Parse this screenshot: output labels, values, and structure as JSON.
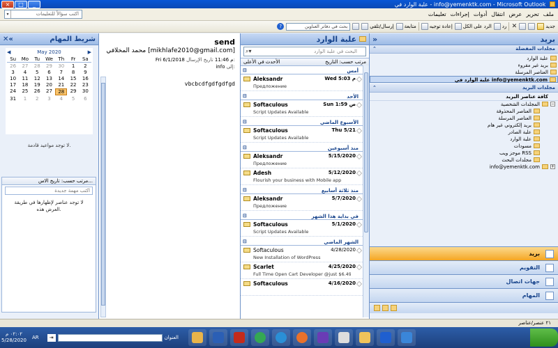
{
  "window": {
    "title": "علبة الوارد في - info@yemenktk.com - Microsoft Outlook",
    "controls": [
      "_",
      "□",
      "×"
    ]
  },
  "menu": {
    "items": [
      "ملف",
      "تحرير",
      "عرض",
      "انتقال",
      "أدوات",
      "إجراءات",
      "تعليمات"
    ],
    "ask_placeholder": "اكتب سؤالاً للتعليمات"
  },
  "toolbar": {
    "new_label": "جديد",
    "reply_label": "رد",
    "reply_all_label": "الرد على الكل",
    "forward_label": "إعادة توجيه",
    "followup_label": "متابعة",
    "sendreceive_label": "إرسال/تلقي",
    "search_placeholder": "بحث في دفاتر العناوين"
  },
  "todo": {
    "title": "شريط المهام",
    "calendar": {
      "month": "May 2020",
      "weekdays": [
        "Su",
        "Mo",
        "Tu",
        "We",
        "Th",
        "Fr",
        "Sa"
      ],
      "cells": [
        "26",
        "27",
        "28",
        "29",
        "30",
        "1",
        "2",
        "3",
        "4",
        "5",
        "6",
        "7",
        "8",
        "9",
        "10",
        "11",
        "12",
        "13",
        "14",
        "15",
        "16",
        "17",
        "18",
        "19",
        "20",
        "21",
        "22",
        "23",
        "24",
        "25",
        "26",
        "27",
        "28",
        "29",
        "30",
        "31",
        "1",
        "2",
        "3",
        "4",
        "5",
        "6"
      ],
      "today": "28"
    },
    "no_appointments": "لا توجد مواعيد قادمة.",
    "tasks": {
      "sort_header": "مرتب حسب: تاريخ الاس...",
      "new_placeholder": "اكتب مهمة جديدة",
      "empty_text": "لا توجد عناصر لإظهارها في طريقة العرض هذه."
    }
  },
  "reading": {
    "subject": "send",
    "from": "محمد المخلافي [mikhlafe2010@gmail.com]",
    "sent_label": "تاريخ الإرسال:",
    "sent_value": "Fri 6/1/2018 م 11:46",
    "to_label": "إلى:",
    "to_value": "info",
    "body": "vbcbcdfgdfgdfgd"
  },
  "inbox": {
    "title": "علبة الوارد",
    "search_placeholder": "البحث في علبة الوارد",
    "sort_by": "مرتب حسب: التاريخ",
    "sort_order": "الأحدث في الأعلى",
    "groups": [
      {
        "label": "أمس",
        "messages": [
          {
            "sender": "Aleksandr",
            "date": "Wed 5:03 م",
            "snippet": "Предложение",
            "read": false
          }
        ]
      },
      {
        "label": "الأحد",
        "messages": [
          {
            "sender": "Softaculous",
            "date": "Sun 1:59 ص",
            "snippet": "Script Updates Available",
            "read": false
          }
        ]
      },
      {
        "label": "الأسبوع الماضي",
        "messages": [
          {
            "sender": "Softaculous",
            "date": "Thu 5/21",
            "snippet": "Script Updates Available",
            "read": false
          }
        ]
      },
      {
        "label": "منذ أسبوعين",
        "messages": [
          {
            "sender": "Aleksandr",
            "date": "5/15/2020",
            "snippet": "Предложение",
            "read": false
          },
          {
            "sender": "Adesh",
            "date": "5/12/2020",
            "snippet": "Flourish your business with Mobile app",
            "read": false
          }
        ]
      },
      {
        "label": "منذ ثلاثة أسابيع",
        "messages": [
          {
            "sender": "Aleksandr",
            "date": "5/7/2020",
            "snippet": "Предложение",
            "read": false
          }
        ]
      },
      {
        "label": "في بداية هذا الشهر",
        "messages": [
          {
            "sender": "Softaculous",
            "date": "5/1/2020",
            "snippet": "Script Updates Available",
            "read": false
          }
        ]
      },
      {
        "label": "الشهر الماضي",
        "messages": [
          {
            "sender": "Softaculous",
            "date": "4/28/2020",
            "snippet": "New Installation of WordPress",
            "read": true
          },
          {
            "sender": "Scarlet",
            "date": "4/25/2020",
            "snippet": "Full Time Open Cart Developer @just $6.49/...",
            "read": false
          },
          {
            "sender": "Softaculous",
            "date": "4/16/2020",
            "snippet": "",
            "read": false
          }
        ]
      }
    ]
  },
  "nav": {
    "title": "بريد",
    "favorites_header": "مجلدات المفضلة",
    "favorites": [
      "علبة الوارد",
      "بريد غير مقروء",
      "العناصر المرسلة",
      "علبة الوارد في info@yemenktk.com"
    ],
    "mail_folders_header": "مجلدات البريد",
    "all_items": "كافة عناصر البريد",
    "tree": [
      {
        "label": "المجلدات الشخصية",
        "level": 1
      },
      {
        "label": "العناصر المحذوفة",
        "level": 2
      },
      {
        "label": "العناصر المرسلة",
        "level": 2
      },
      {
        "label": "بريد إلكتروني غير هام",
        "level": 2
      },
      {
        "label": "علبة الصادر",
        "level": 2
      },
      {
        "label": "علبة الوارد",
        "level": 2
      },
      {
        "label": "مسودات",
        "level": 2
      },
      {
        "label": "موجز ويب RSS",
        "level": 2
      },
      {
        "label": "مجلدات البحث",
        "level": 2
      },
      {
        "label": "info@yemenktk.com",
        "level": 1
      }
    ],
    "buttons": [
      "بريد",
      "التقويم",
      "جهات اتصال",
      "المهام"
    ]
  },
  "status": {
    "count": "٢١ عنصر/عناصر"
  },
  "taskbar": {
    "time": "٠٢:٠٢ م",
    "date": "5/28/2020",
    "lang": "AR",
    "address_label": "العنوان"
  }
}
